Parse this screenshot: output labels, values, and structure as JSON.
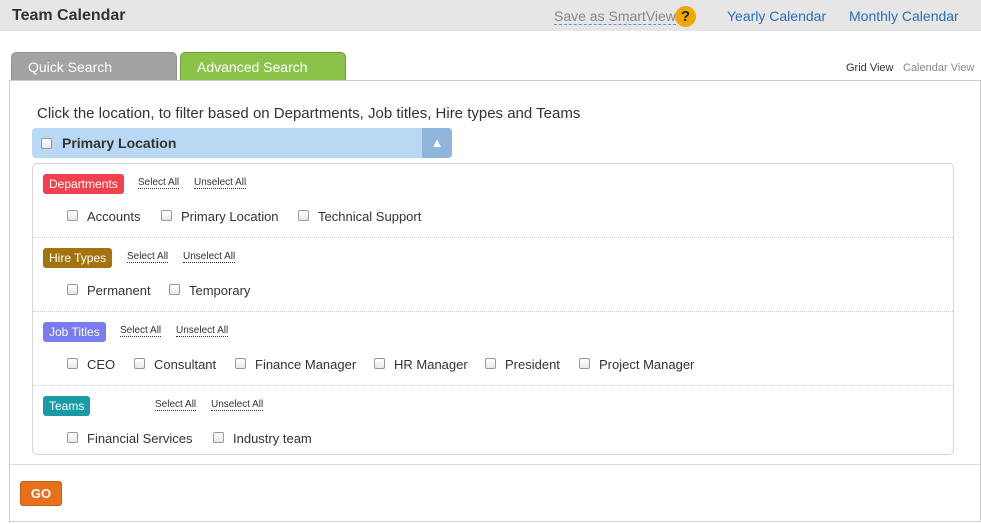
{
  "header": {
    "title": "Team Calendar",
    "save_smartview": "Save as SmartView",
    "help_glyph": "?",
    "yearly_calendar": "Yearly Calendar",
    "monthly_calendar": "Monthly Calendar"
  },
  "tabs": {
    "quick_search": "Quick Search",
    "advanced_search": "Advanced Search",
    "active": "advanced_search"
  },
  "views": {
    "grid_view": "Grid View",
    "calendar_view": "Calendar View",
    "active": "grid_view"
  },
  "instruction": "Click the location, to filter based on Departments, Job titles, Hire types and Teams",
  "location": {
    "label": "Primary Location",
    "toggle_glyph": "▲",
    "checked": false
  },
  "groups": [
    {
      "name": "Departments",
      "color": "#f2414d",
      "select_all": "Select All",
      "unselect_all": "Unselect All",
      "options": [
        {
          "label": "Accounts",
          "checked": false
        },
        {
          "label": "Primary Location",
          "checked": false
        },
        {
          "label": "Technical Support",
          "checked": false
        }
      ]
    },
    {
      "name": "Hire Types",
      "color": "#a3730f",
      "select_all": "Select All",
      "unselect_all": "Unselect All",
      "options": [
        {
          "label": "Permanent",
          "checked": false
        },
        {
          "label": "Temporary",
          "checked": false
        }
      ]
    },
    {
      "name": "Job Titles",
      "color": "#7b7bf0",
      "select_all": "Select All",
      "unselect_all": "Unselect All",
      "options": [
        {
          "label": "CEO",
          "checked": false
        },
        {
          "label": "Consultant",
          "checked": false
        },
        {
          "label": "Finance Manager",
          "checked": false
        },
        {
          "label": "HR Manager",
          "checked": false
        },
        {
          "label": "President",
          "checked": false
        },
        {
          "label": "Project Manager",
          "checked": false
        }
      ]
    },
    {
      "name": "Teams",
      "color": "#1a9aa6",
      "select_all": "Select All",
      "unselect_all": "Unselect All",
      "options": [
        {
          "label": "Financial Services",
          "checked": false
        },
        {
          "label": "Industry team",
          "checked": false
        }
      ]
    }
  ],
  "go_button": "GO",
  "colors": {
    "tab_active": "#8bc34a",
    "tab_inactive": "#a3a3a3",
    "link": "#2a6ebb",
    "location_bar": "#b8d8f3",
    "go_button": "#e6711d"
  }
}
